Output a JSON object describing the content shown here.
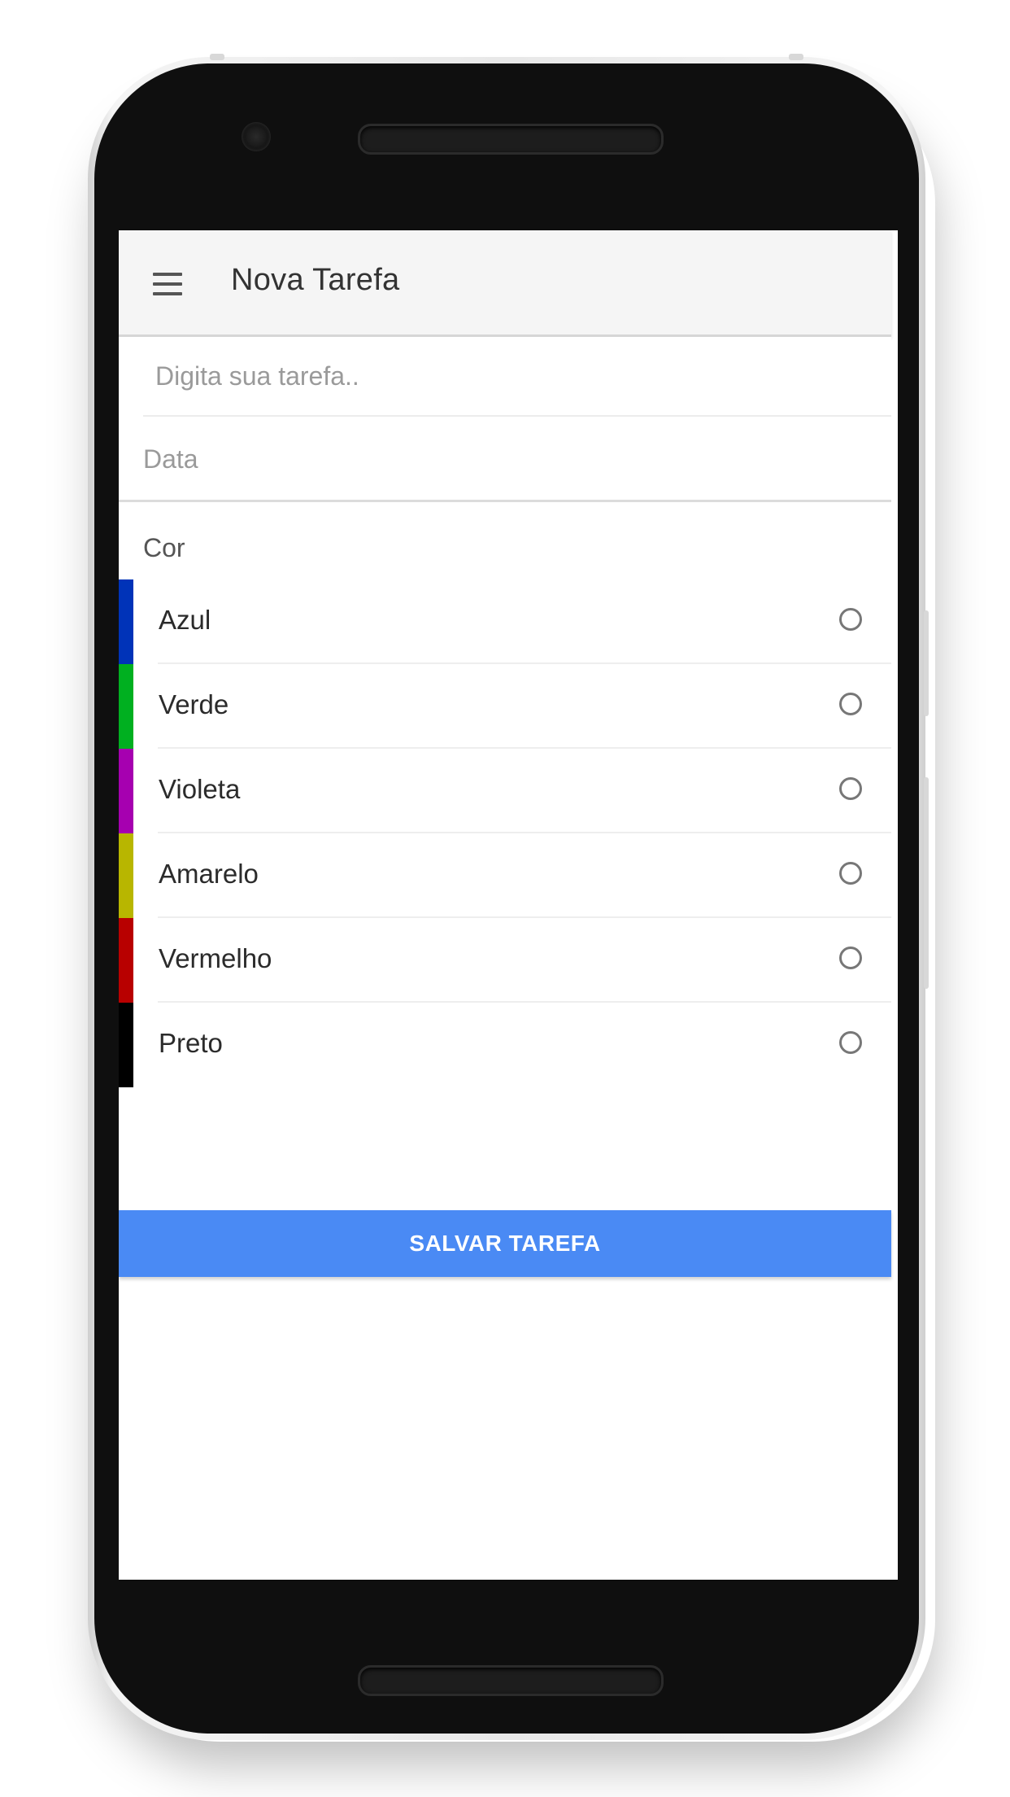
{
  "appbar": {
    "menu_icon": "hamburger-menu-icon",
    "title": "Nova Tarefa"
  },
  "form": {
    "task_placeholder": "Digita sua tarefa..",
    "task_value": "",
    "date_placeholder": "Data",
    "date_value": "",
    "color_section_label": "Cor",
    "colors": [
      {
        "label": "Azul",
        "swatch": "#0033b8",
        "selected": false
      },
      {
        "label": "Verde",
        "swatch": "#00b020",
        "selected": false
      },
      {
        "label": "Violeta",
        "swatch": "#a600b0",
        "selected": false
      },
      {
        "label": "Amarelo",
        "swatch": "#b8b600",
        "selected": false
      },
      {
        "label": "Vermelho",
        "swatch": "#b80000",
        "selected": false
      },
      {
        "label": "Preto",
        "swatch": "#000000",
        "selected": false
      }
    ],
    "save_label": "SALVAR TAREFA"
  },
  "theme": {
    "primary_button": "#4a8af4",
    "appbar_background": "#f5f5f5"
  }
}
